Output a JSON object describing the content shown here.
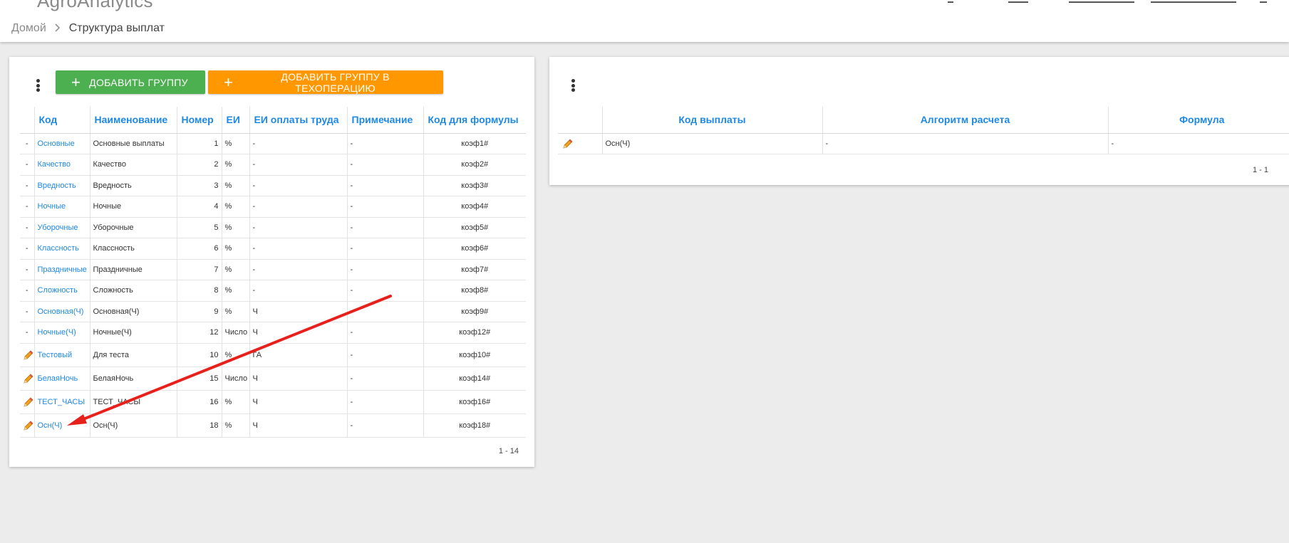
{
  "header": {
    "app_title": "AgroAnalytics"
  },
  "breadcrumb": {
    "home": "Домой",
    "current": "Структура выплат"
  },
  "left_panel": {
    "add_group_label": "ДОБАВИТЬ ГРУППУ",
    "add_group_to_op_label": "ДОБАВИТЬ ГРУППУ В ТЕХОПЕРАЦИЮ",
    "columns": [
      "Код",
      "Наименование",
      "Номер",
      "ЕИ",
      "ЕИ оплаты труда",
      "Примечание",
      "Код для формулы"
    ],
    "rows": [
      {
        "action": "-",
        "code": "Основные",
        "name": "Основные выплаты",
        "number": "1",
        "unit": "%",
        "pay_unit": "-",
        "note": "-",
        "formula_code": "коэф1#"
      },
      {
        "action": "-",
        "code": "Качество",
        "name": "Качество",
        "number": "2",
        "unit": "%",
        "pay_unit": "-",
        "note": "-",
        "formula_code": "коэф2#"
      },
      {
        "action": "-",
        "code": "Вредность",
        "name": "Вредность",
        "number": "3",
        "unit": "%",
        "pay_unit": "-",
        "note": "-",
        "formula_code": "коэф3#"
      },
      {
        "action": "-",
        "code": "Ночные",
        "name": "Ночные",
        "number": "4",
        "unit": "%",
        "pay_unit": "-",
        "note": "-",
        "formula_code": "коэф4#"
      },
      {
        "action": "-",
        "code": "Уборочные",
        "name": "Уборочные",
        "number": "5",
        "unit": "%",
        "pay_unit": "-",
        "note": "-",
        "formula_code": "коэф5#"
      },
      {
        "action": "-",
        "code": "Классность",
        "name": "Классность",
        "number": "6",
        "unit": "%",
        "pay_unit": "-",
        "note": "-",
        "formula_code": "коэф6#"
      },
      {
        "action": "-",
        "code": "Праздничные",
        "name": "Праздничные",
        "number": "7",
        "unit": "%",
        "pay_unit": "-",
        "note": "-",
        "formula_code": "коэф7#"
      },
      {
        "action": "-",
        "code": "Сложность",
        "name": "Сложность",
        "number": "8",
        "unit": "%",
        "pay_unit": "-",
        "note": "-",
        "formula_code": "коэф8#"
      },
      {
        "action": "-",
        "code": "Основная(Ч)",
        "name": "Основная(Ч)",
        "number": "9",
        "unit": "%",
        "pay_unit": "Ч",
        "note": "-",
        "formula_code": "коэф9#"
      },
      {
        "action": "-",
        "code": "Ночные(Ч)",
        "name": "Ночные(Ч)",
        "number": "12",
        "unit": "Число",
        "pay_unit": "Ч",
        "note": "-",
        "formula_code": "коэф12#"
      },
      {
        "action": "edit",
        "code": "Тестовый",
        "name": "Для теста",
        "number": "10",
        "unit": "%",
        "pay_unit": "ГА",
        "note": "-",
        "formula_code": "коэф10#"
      },
      {
        "action": "edit",
        "code": "БелаяНочь",
        "name": "БелаяНочь",
        "number": "15",
        "unit": "Число",
        "pay_unit": "Ч",
        "note": "-",
        "formula_code": "коэф14#"
      },
      {
        "action": "edit",
        "code": "ТЕСТ_ЧАСЫ",
        "name": "ТЕСТ_ЧАСЫ",
        "number": "16",
        "unit": "%",
        "pay_unit": "Ч",
        "note": "-",
        "formula_code": "коэф16#"
      },
      {
        "action": "edit",
        "code": "Осн(Ч)",
        "name": "Осн(Ч)",
        "number": "18",
        "unit": "%",
        "pay_unit": "Ч",
        "note": "-",
        "formula_code": "коэф18#"
      }
    ],
    "pager": "1 - 14"
  },
  "right_panel": {
    "columns": [
      "Код выплаты",
      "Алгоритм расчета",
      "Формула"
    ],
    "rows": [
      {
        "action": "edit",
        "payment_code": "Осн(Ч)",
        "algorithm": "-",
        "formula": "-"
      }
    ],
    "pager": "1 - 1"
  },
  "colors": {
    "accent_blue": "#1e88e5",
    "btn_green": "#4caf50",
    "btn_orange": "#ff9800",
    "arrow_red": "#e8201c",
    "pencil_orange": "#f0a020"
  },
  "icons": {
    "menu": "kebab-menu-icon",
    "add": "plus-icon",
    "edit": "pencil-icon",
    "breadcrumb_separator": "chevron-right-icon"
  }
}
